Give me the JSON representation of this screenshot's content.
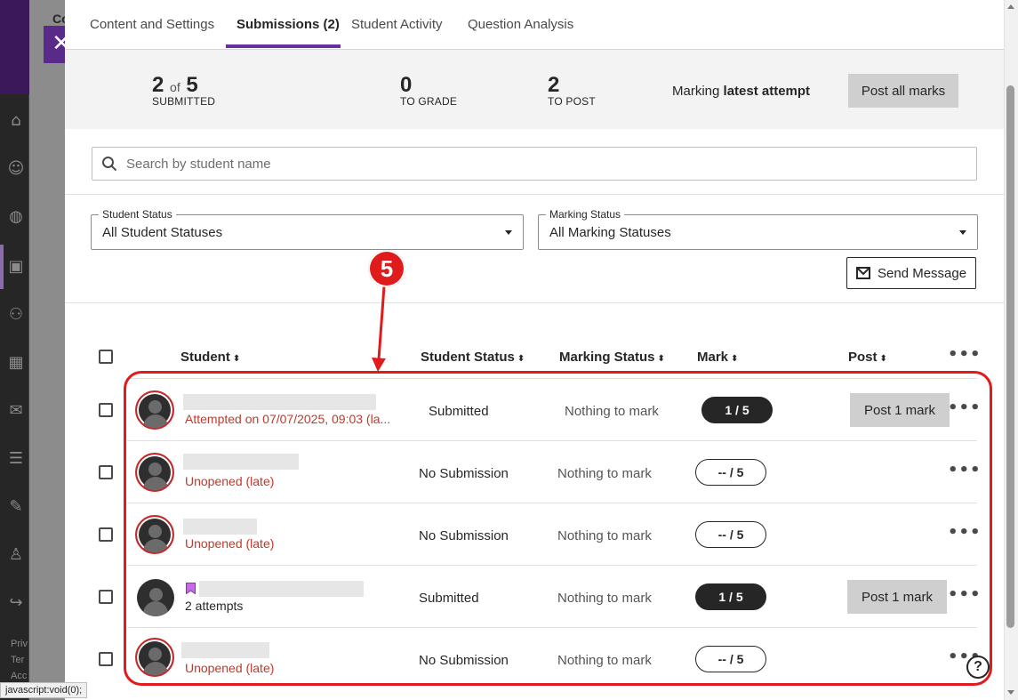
{
  "background": {
    "title_fragment": "Co",
    "footer_lines": [
      "Priv",
      "Ter",
      "Acc"
    ]
  },
  "tabs": [
    {
      "label": "Content and Settings"
    },
    {
      "label": "Submissions (2)"
    },
    {
      "label": "Student Activity"
    },
    {
      "label": "Question Analysis"
    }
  ],
  "summary": {
    "submitted": {
      "value": "2",
      "of_text": "of",
      "total": "5",
      "label": "SUBMITTED"
    },
    "to_grade": {
      "value": "0",
      "label": "TO GRADE"
    },
    "to_post": {
      "value": "2",
      "label": "TO POST"
    },
    "marking_prefix": "Marking",
    "marking_mode": "latest attempt",
    "post_all_label": "Post all marks"
  },
  "search": {
    "placeholder": "Search by student name",
    "value": ""
  },
  "filters": {
    "student_status": {
      "legend": "Student Status",
      "selected": "All Student Statuses"
    },
    "marking_status": {
      "legend": "Marking Status",
      "selected": "All Marking Statuses"
    }
  },
  "send_message_label": "Send Message",
  "table": {
    "headers": {
      "student": "Student",
      "student_status": "Student Status",
      "marking_status": "Marking Status",
      "mark": "Mark",
      "post": "Post"
    },
    "sort_glyph": "⬍",
    "rows": [
      {
        "subtitle": "Attempted on 07/07/2025, 09:03 (la...",
        "student_status": "Submitted",
        "marking_status": "Nothing to mark",
        "mark": "1  / 5",
        "post_label": "Post 1 mark"
      },
      {
        "subtitle": "Unopened (late)",
        "student_status": "No Submission",
        "marking_status": "Nothing to mark",
        "mark": "--  / 5",
        "post_label": ""
      },
      {
        "subtitle": "Unopened (late)",
        "student_status": "No Submission",
        "marking_status": "Nothing to mark",
        "mark": "--  / 5",
        "post_label": ""
      },
      {
        "subtitle": "2 attempts",
        "student_status": "Submitted",
        "marking_status": "Nothing to mark",
        "mark": "1  / 5",
        "post_label": "Post 1 mark"
      },
      {
        "subtitle": "Unopened (late)",
        "student_status": "No Submission",
        "marking_status": "Nothing to mark",
        "mark": "--  / 5",
        "post_label": ""
      }
    ]
  },
  "annotation": {
    "callout_number": "5"
  },
  "help_label": "?",
  "status_bar": "javascript:void(0);",
  "colors": {
    "accent": "#6a2ea3",
    "late_red": "#c0392b",
    "annotation_red": "#e01b1b"
  }
}
